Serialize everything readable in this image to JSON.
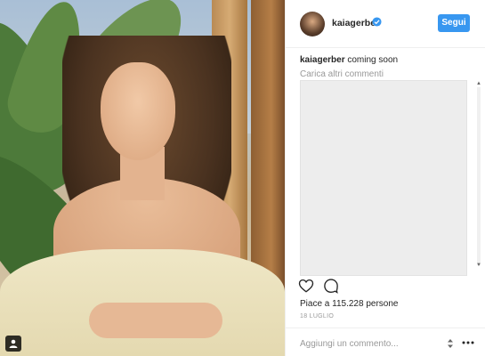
{
  "post": {
    "username": "kaiagerber",
    "follow_label": "Segui",
    "caption_text": "coming soon",
    "load_more_label": "Carica altri commenti",
    "likes_text": "Piace a 115.228 persone",
    "date_text": "18 LUGLIO",
    "comment_placeholder": "Aggiungi un commento..."
  },
  "icons": {
    "verified": "verified-badge-icon",
    "heart": "heart-icon",
    "comment": "comment-icon",
    "more": "more-options-icon",
    "user_tag": "user-tag-icon"
  },
  "colors": {
    "accent": "#3897f0",
    "text": "#262626",
    "muted": "#999999"
  }
}
